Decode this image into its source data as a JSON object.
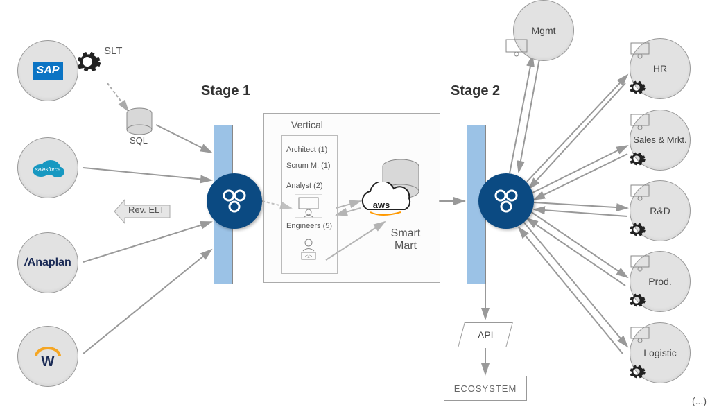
{
  "slt_label": "SLT",
  "sql_label": "SQL",
  "rev_elt_label": "Rev. ELT",
  "stage1_label": "Stage 1",
  "stage2_label": "Stage 2",
  "vertical_label": "Vertical",
  "roles": {
    "architect": "Architect (1)",
    "scrum": "Scrum M. (1)",
    "analyst": "Analyst (2)",
    "engineers": "Engineers (5)"
  },
  "aws_label": "aws",
  "smart_mart_label": "Smart Mart",
  "api_label": "API",
  "ecosystem_label": "ECOSYSTEM",
  "sources": {
    "sap": "SAP",
    "salesforce": "salesforce",
    "anaplan": "Anaplan",
    "workday": "W"
  },
  "departments": {
    "mgmt": "Mgmt",
    "hr": "HR",
    "sales": "Sales & Mrkt.",
    "rd": "R&D",
    "prod": "Prod.",
    "logistic": "Logistic"
  },
  "ellipsis": "(...)"
}
